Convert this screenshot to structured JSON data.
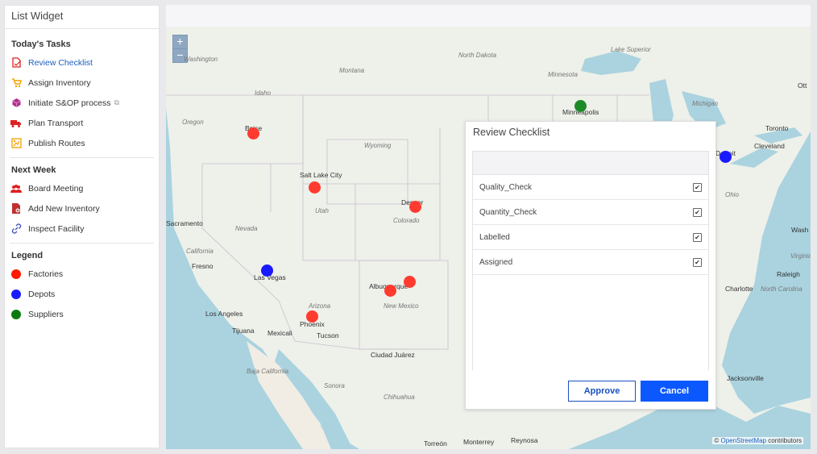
{
  "sidebar": {
    "title": "List Widget",
    "sections": [
      {
        "heading": "Today's Tasks",
        "items": [
          {
            "label": "Review Checklist",
            "icon": "checklist-icon",
            "color": "#e02020"
          },
          {
            "label": "Assign Inventory",
            "icon": "cart-icon",
            "color": "#f0a000"
          },
          {
            "label": "Initiate S&OP process",
            "icon": "cube-icon",
            "color": "#b0308f"
          },
          {
            "label": "Plan Transport",
            "icon": "truck-icon",
            "color": "#e02020"
          },
          {
            "label": "Publish Routes",
            "icon": "map-icon",
            "color": "#f0a000"
          }
        ]
      },
      {
        "heading": "Next Week",
        "items": [
          {
            "label": "Board Meeting",
            "icon": "people-icon",
            "color": "#e02020"
          },
          {
            "label": "Add New Inventory",
            "icon": "document-icon",
            "color": "#c03030"
          },
          {
            "label": "Inspect Facility",
            "icon": "link-icon",
            "color": "#4050c0"
          }
        ]
      },
      {
        "heading": "Legend",
        "items": [
          {
            "label": "Factories",
            "color": "#ff1a00"
          },
          {
            "label": "Depots",
            "color": "#1a1aff"
          },
          {
            "label": "Suppliers",
            "color": "#0e7a0e"
          }
        ]
      }
    ]
  },
  "map": {
    "zoom_in": "+",
    "zoom_out": "−",
    "labels": {
      "washington": "Washington",
      "idaho": "Idaho",
      "montana": "Montana",
      "north_dakota": "North Dakota",
      "minnesota": "Minnesota",
      "oregon": "Oregon",
      "wyoming": "Wyoming",
      "lake_superior": "Lake Superior",
      "michigan": "Michigan",
      "nevada": "Nevada",
      "utah": "Utah",
      "colorado": "Colorado",
      "california": "California",
      "arizona": "Arizona",
      "new_mexico": "New Mexico",
      "baja": "Baja California",
      "sonora": "Sonora",
      "chihuahua": "Chihuahua",
      "ohio": "Ohio",
      "boise": "Boise",
      "minneapolis": "Minneapolis",
      "salt_lake": "Salt Lake City",
      "denver": "Denver",
      "sacramento": "Sacramento",
      "fresno": "Fresno",
      "las_vegas": "Las Vegas",
      "los_angeles": "Los Angeles",
      "tijuana": "Tijuana",
      "mexicali": "Mexicali",
      "phoenix": "Phoenix",
      "tucson": "Tucson",
      "albuquerque": "Albuquerque",
      "ciudad_juarez": "Ciudad Juárez",
      "torreon": "Torreón",
      "monterrey": "Monterrey",
      "reynosa": "Reynosa",
      "toronto": "Toronto",
      "ottawa": "Ott",
      "detroit": "Detroit",
      "cleveland": "Cleveland",
      "washington_dc": "Wash",
      "raleigh": "Raleigh",
      "charlotte": "Charlotte",
      "north_carolina": "North Carolina",
      "jacksonville": "Jacksonville",
      "virginia": "Virginia"
    },
    "attribution_prefix": "© ",
    "attribution_link": "OpenStreetMap",
    "attribution_suffix": " contributors"
  },
  "dialog": {
    "title": "Review Checklist",
    "rows": [
      {
        "label": "Quality_Check",
        "checked": true
      },
      {
        "label": "Quantity_Check",
        "checked": true
      },
      {
        "label": "Labelled",
        "checked": true
      },
      {
        "label": "Assigned",
        "checked": true
      }
    ],
    "check_glyph": "✔",
    "approve_label": "Approve",
    "cancel_label": "Cancel"
  }
}
